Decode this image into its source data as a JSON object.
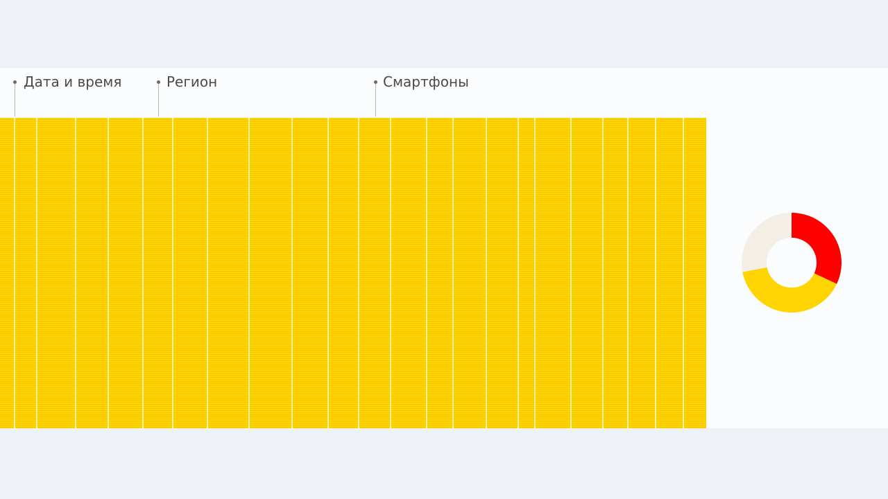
{
  "columns": {
    "datetime_label": "Дата и время",
    "region_label": "Регион",
    "smartphones_label": "Смартфоны"
  },
  "colors": {
    "table_fill": "#ffd400",
    "donut_red": "#ff0000",
    "donut_yellow": "#ffd400",
    "donut_beige": "#f3efe6"
  },
  "chart_data": {
    "type": "pie",
    "variant": "donut",
    "segments": [
      {
        "color": "#ff0000",
        "value": 32
      },
      {
        "color": "#ffd400",
        "value": 40
      },
      {
        "color": "#f3efe6",
        "value": 28
      }
    ],
    "title": "",
    "legend": "none"
  }
}
